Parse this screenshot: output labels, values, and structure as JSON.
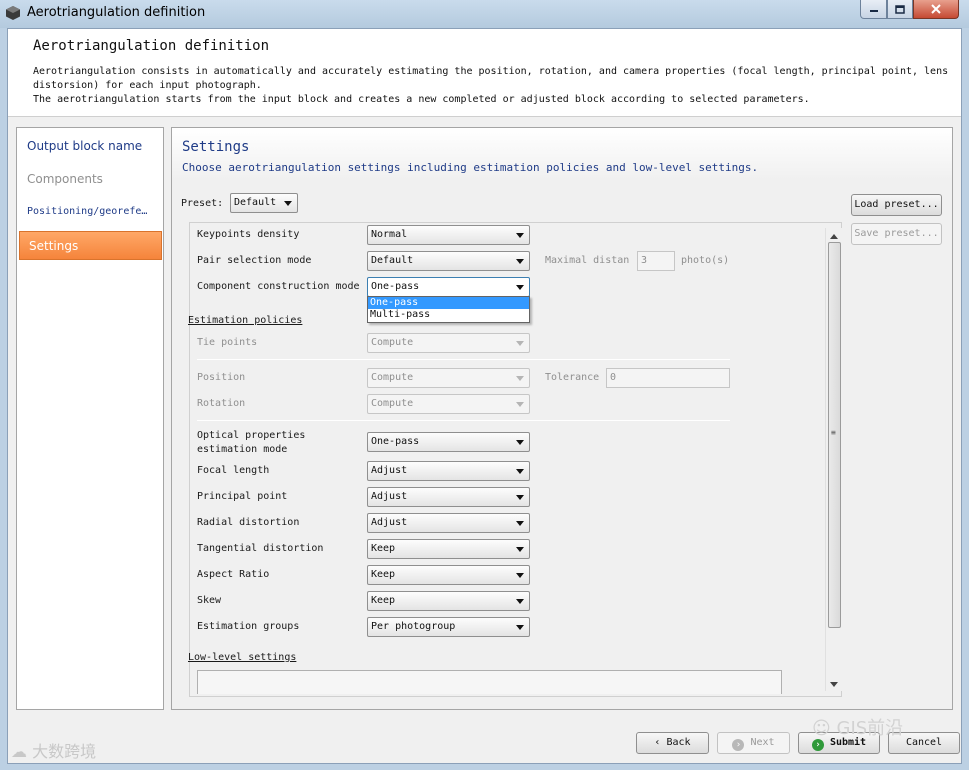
{
  "window": {
    "title": "Aerotriangulation definition"
  },
  "header": {
    "title": "Aerotriangulation definition",
    "description_1": "Aerotriangulation consists in automatically and accurately estimating the position, rotation, and camera properties (focal length, principal point, lens distorsion) for each input photograph.",
    "description_2": "The aerotriangulation starts from the input block and creates a new completed or adjusted block according to selected parameters."
  },
  "sidebar": {
    "items": [
      {
        "label": "Output block name"
      },
      {
        "label": "Components"
      },
      {
        "label": "Positioning/georefe…"
      },
      {
        "label": "Settings"
      }
    ]
  },
  "settings": {
    "title": "Settings",
    "description": "Choose aerotriangulation settings including estimation policies and low-level settings.",
    "preset_label": "Preset:",
    "preset_value": "Default",
    "load_preset": "Load preset...",
    "save_preset": "Save preset...",
    "keypoints_density": {
      "label": "Keypoints density",
      "value": "Normal"
    },
    "pair_selection_mode": {
      "label": "Pair selection mode",
      "value": "Default",
      "max_dist_label": "Maximal distan",
      "max_dist_value": "3",
      "unit": "photo(s)"
    },
    "component_construction_mode": {
      "label": "Component construction mode",
      "value": "One-pass",
      "options": [
        "One-pass",
        "Multi-pass"
      ]
    },
    "estimation_policies_heading": "Estimation policies",
    "tie_points": {
      "label": "Tie points",
      "value": "Compute"
    },
    "position": {
      "label": "Position",
      "value": "Compute",
      "tolerance_label": "Tolerance",
      "tolerance_value": "0"
    },
    "rotation": {
      "label": "Rotation",
      "value": "Compute"
    },
    "optical_properties": {
      "label_1": "Optical properties",
      "label_2": "estimation mode",
      "value": "One-pass"
    },
    "focal_length": {
      "label": "Focal length",
      "value": "Adjust"
    },
    "principal_point": {
      "label": "Principal point",
      "value": "Adjust"
    },
    "radial_distortion": {
      "label": "Radial distortion",
      "value": "Adjust"
    },
    "tangential_distortion": {
      "label": "Tangential distortion",
      "value": "Keep"
    },
    "aspect_ratio": {
      "label": "Aspect Ratio",
      "value": "Keep"
    },
    "skew": {
      "label": "Skew",
      "value": "Keep"
    },
    "estimation_groups": {
      "label": "Estimation groups",
      "value": "Per photogroup"
    },
    "low_level_heading": "Low-level settings"
  },
  "footer": {
    "back": "Back",
    "next": "Next",
    "submit": "Submit",
    "cancel": "Cancel"
  },
  "watermark": {
    "left": "大数跨境",
    "right": "GIS前沿"
  },
  "colors": {
    "accent": "#f5843b",
    "link": "#1f3b87",
    "selection": "#3399ff"
  }
}
